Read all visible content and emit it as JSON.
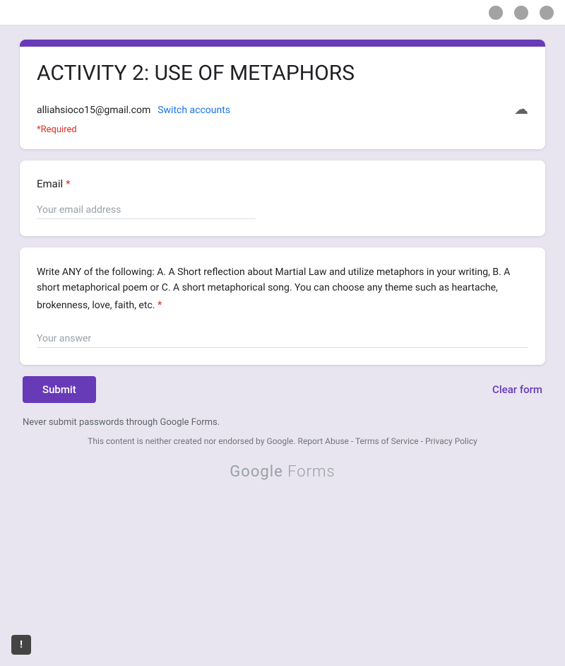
{
  "topbar": {
    "icons": [
      "profile-icon",
      "bookmark-icon",
      "menu-icon"
    ]
  },
  "header": {
    "accent_color": "#673ab7",
    "title": "ACTIVITY 2: USE OF METAPHORS",
    "account_email": "alliahsioco15@gmail.com",
    "switch_accounts_label": "Switch accounts",
    "required_note": "*Required"
  },
  "email_section": {
    "label": "Email",
    "required": true,
    "placeholder": "Your email address"
  },
  "question_section": {
    "question_text": "Write ANY of the following: A. A Short reflection about Martial Law and utilize metaphors in your writing, B. A short metaphorical poem or C. A short metaphorical song. You can choose any theme such as heartache, brokenness, love, faith, etc.",
    "required": true,
    "placeholder": "Your answer"
  },
  "buttons": {
    "submit_label": "Submit",
    "clear_form_label": "Clear form"
  },
  "footer": {
    "warning_text": "Never submit passwords through Google Forms.",
    "legal_text": "This content is neither created nor endorsed by Google.",
    "report_abuse_label": "Report Abuse",
    "terms_label": "Terms of Service",
    "privacy_label": "Privacy Policy",
    "logo_google": "Google",
    "logo_forms": "Forms"
  },
  "error_icon": "!"
}
